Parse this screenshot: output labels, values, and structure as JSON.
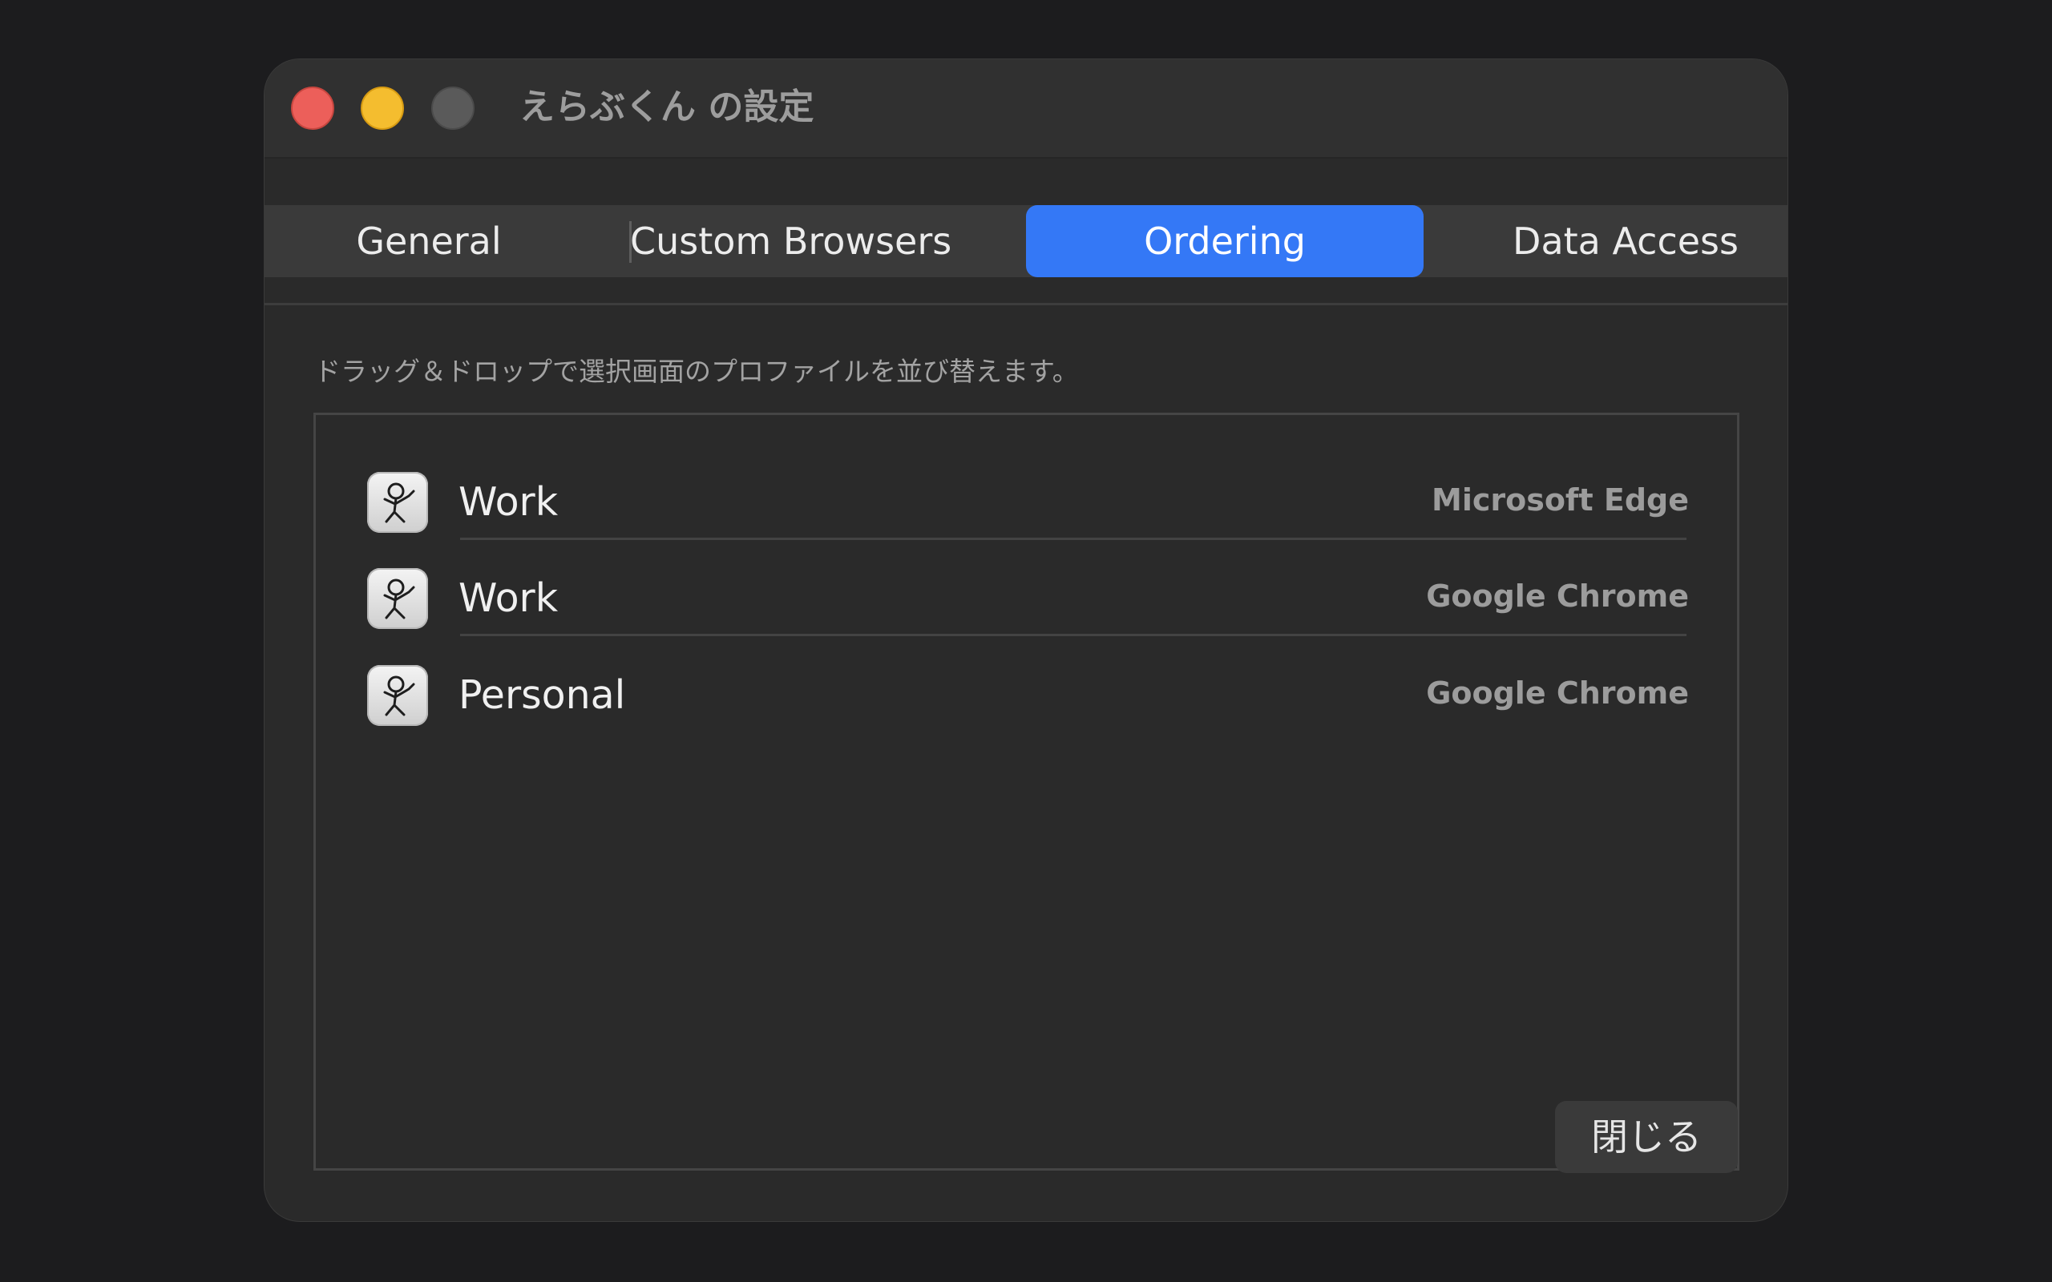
{
  "window": {
    "title": "えらぶくん の設定"
  },
  "tabs": [
    {
      "label": "General",
      "selected": false
    },
    {
      "label": "Custom Browsers",
      "selected": false
    },
    {
      "label": "Ordering",
      "selected": true
    },
    {
      "label": "Data Access",
      "selected": false
    }
  ],
  "ordering": {
    "instruction": "ドラッグ＆ドロップで選択画面のプロファイルを並び替えます。",
    "profiles": [
      {
        "name": "Work",
        "browser": "Microsoft Edge",
        "icon": "app-icon"
      },
      {
        "name": "Work",
        "browser": "Google Chrome",
        "icon": "app-icon"
      },
      {
        "name": "Personal",
        "browser": "Google Chrome",
        "icon": "app-icon"
      }
    ]
  },
  "footer": {
    "close_label": "閉じる"
  },
  "colors": {
    "accent": "#3478f6",
    "window_background": "#2a2a2a",
    "close_light": "#ec5f5a",
    "minimize_light": "#f4bd2f",
    "zoom_light_inactive": "#5a5a5a"
  }
}
